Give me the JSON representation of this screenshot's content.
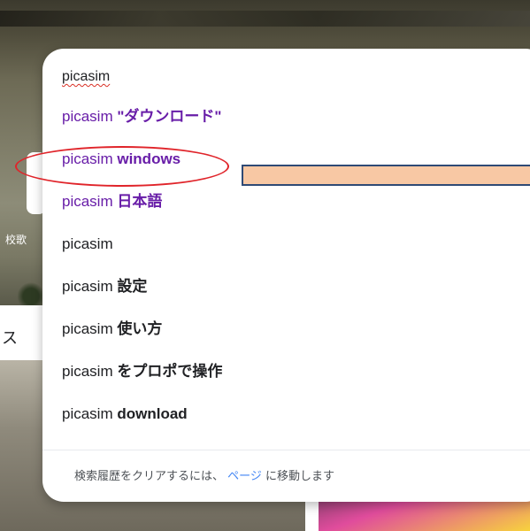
{
  "background": {
    "caption": "校歌",
    "strip_text": "ス"
  },
  "search": {
    "query": "picasim"
  },
  "suggestions": [
    {
      "prefix": "picasim",
      "rest": " \"ダウンロード\"",
      "visited": true
    },
    {
      "prefix": "picasim",
      "rest": " windows",
      "visited": true
    },
    {
      "prefix": "picasim",
      "rest": " 日本語",
      "visited": true
    },
    {
      "prefix": "picasim",
      "rest": "",
      "visited": false
    },
    {
      "prefix": "picasim",
      "rest": " 設定",
      "visited": false
    },
    {
      "prefix": "picasim",
      "rest": " 使い方",
      "visited": false
    },
    {
      "prefix": "picasim",
      "rest": " をプロポで操作",
      "visited": false
    },
    {
      "prefix": "picasim",
      "rest": " download",
      "visited": false
    }
  ],
  "footer": {
    "before": "検索履歴をクリアするには、",
    "link": "ページ",
    "after": "に移動します"
  },
  "colors": {
    "visited": "#681da8",
    "annotation_ellipse": "#e0242a",
    "annotation_rect_fill": "#f8c8a4",
    "annotation_rect_border": "#2f4a75"
  }
}
